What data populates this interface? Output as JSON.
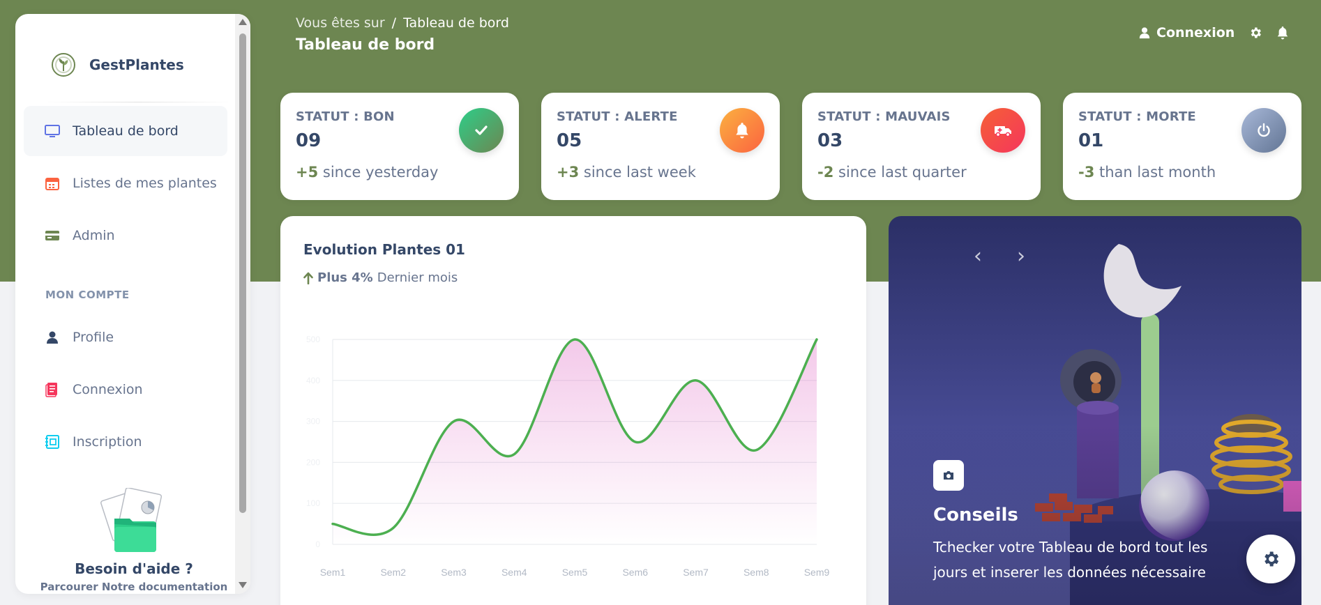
{
  "brand": {
    "name": "GestPlantes"
  },
  "sidebar": {
    "items": [
      {
        "label": "Tableau de bord",
        "icon": "monitor-icon",
        "active": true
      },
      {
        "label": "Listes de mes plantes",
        "icon": "calendar-icon"
      },
      {
        "label": "Admin",
        "icon": "credit-card-icon"
      }
    ],
    "section_title": "MON COMPTE",
    "account_items": [
      {
        "label": "Profile",
        "icon": "user-icon"
      },
      {
        "label": "Connexion",
        "icon": "document-icon"
      },
      {
        "label": "Inscription",
        "icon": "notebook-icon"
      }
    ],
    "help": {
      "title": "Besoin d'aide ?",
      "subtitle": "Parcourer Notre documentation"
    }
  },
  "header": {
    "breadcrumb_prefix": "Vous êtes sur",
    "breadcrumb_sep": "/",
    "breadcrumb_current": "Tableau de bord",
    "title": "Tableau de bord",
    "login_label": "Connexion"
  },
  "stats": [
    {
      "label": "STATUT : BON",
      "value": "09",
      "delta": "+5",
      "foot": "since yesterday",
      "icon": "check-icon",
      "color_from": "#2dce89",
      "color_to": "#6d8651"
    },
    {
      "label": "STATUT : ALERTE",
      "value": "05",
      "delta": "+3",
      "foot": "since last week",
      "icon": "bell-icon",
      "color_from": "#fbb140",
      "color_to": "#fb6340"
    },
    {
      "label": "STATUT : MAUVAIS",
      "value": "03",
      "delta": "-2",
      "foot": "since last quarter",
      "icon": "ambulance-icon",
      "color_from": "#f5365c",
      "color_to": "#f56036"
    },
    {
      "label": "STATUT : MORTE",
      "value": "01",
      "delta": "-3",
      "foot": "than last month",
      "icon": "power-icon",
      "color_from": "#a8b8d8",
      "color_to": "#627594"
    }
  ],
  "chart": {
    "title": "Evolution Plantes 01",
    "trend_strong": "Plus 4%",
    "trend_text": "Dernier mois"
  },
  "chart_data": {
    "type": "area",
    "title": "Evolution Plantes 01",
    "categories": [
      "Sem1",
      "Sem2",
      "Sem3",
      "Sem4",
      "Sem5",
      "Sem6",
      "Sem7",
      "Sem8",
      "Sem9"
    ],
    "series": [
      {
        "values": [
          50,
          40,
          300,
          220,
          500,
          250,
          400,
          230,
          500
        ]
      }
    ],
    "yticks": [
      "0",
      "100",
      "200",
      "300",
      "400",
      "500"
    ],
    "ylim": [
      0,
      500
    ],
    "grid": true,
    "line_color": "#4caf50",
    "fill_color": "#cb0c9f"
  },
  "carousel": {
    "title": "Conseils",
    "text": "Tchecker votre Tableau de bord tout les jours et inserer les données nécessaire",
    "prev_label": "‹",
    "next_label": "›"
  },
  "colors": {
    "banner": "#6d8651",
    "accent": "#6d8651"
  }
}
